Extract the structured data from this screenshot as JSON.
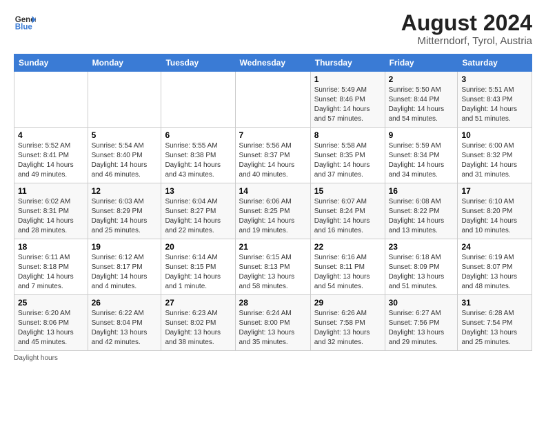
{
  "header": {
    "logo_general": "General",
    "logo_blue": "Blue",
    "month_year": "August 2024",
    "location": "Mitterndorf, Tyrol, Austria"
  },
  "days_of_week": [
    "Sunday",
    "Monday",
    "Tuesday",
    "Wednesday",
    "Thursday",
    "Friday",
    "Saturday"
  ],
  "footnote": "Daylight hours",
  "weeks": [
    [
      {
        "day": "",
        "info": ""
      },
      {
        "day": "",
        "info": ""
      },
      {
        "day": "",
        "info": ""
      },
      {
        "day": "",
        "info": ""
      },
      {
        "day": "1",
        "info": "Sunrise: 5:49 AM\nSunset: 8:46 PM\nDaylight: 14 hours\nand 57 minutes."
      },
      {
        "day": "2",
        "info": "Sunrise: 5:50 AM\nSunset: 8:44 PM\nDaylight: 14 hours\nand 54 minutes."
      },
      {
        "day": "3",
        "info": "Sunrise: 5:51 AM\nSunset: 8:43 PM\nDaylight: 14 hours\nand 51 minutes."
      }
    ],
    [
      {
        "day": "4",
        "info": "Sunrise: 5:52 AM\nSunset: 8:41 PM\nDaylight: 14 hours\nand 49 minutes."
      },
      {
        "day": "5",
        "info": "Sunrise: 5:54 AM\nSunset: 8:40 PM\nDaylight: 14 hours\nand 46 minutes."
      },
      {
        "day": "6",
        "info": "Sunrise: 5:55 AM\nSunset: 8:38 PM\nDaylight: 14 hours\nand 43 minutes."
      },
      {
        "day": "7",
        "info": "Sunrise: 5:56 AM\nSunset: 8:37 PM\nDaylight: 14 hours\nand 40 minutes."
      },
      {
        "day": "8",
        "info": "Sunrise: 5:58 AM\nSunset: 8:35 PM\nDaylight: 14 hours\nand 37 minutes."
      },
      {
        "day": "9",
        "info": "Sunrise: 5:59 AM\nSunset: 8:34 PM\nDaylight: 14 hours\nand 34 minutes."
      },
      {
        "day": "10",
        "info": "Sunrise: 6:00 AM\nSunset: 8:32 PM\nDaylight: 14 hours\nand 31 minutes."
      }
    ],
    [
      {
        "day": "11",
        "info": "Sunrise: 6:02 AM\nSunset: 8:31 PM\nDaylight: 14 hours\nand 28 minutes."
      },
      {
        "day": "12",
        "info": "Sunrise: 6:03 AM\nSunset: 8:29 PM\nDaylight: 14 hours\nand 25 minutes."
      },
      {
        "day": "13",
        "info": "Sunrise: 6:04 AM\nSunset: 8:27 PM\nDaylight: 14 hours\nand 22 minutes."
      },
      {
        "day": "14",
        "info": "Sunrise: 6:06 AM\nSunset: 8:25 PM\nDaylight: 14 hours\nand 19 minutes."
      },
      {
        "day": "15",
        "info": "Sunrise: 6:07 AM\nSunset: 8:24 PM\nDaylight: 14 hours\nand 16 minutes."
      },
      {
        "day": "16",
        "info": "Sunrise: 6:08 AM\nSunset: 8:22 PM\nDaylight: 14 hours\nand 13 minutes."
      },
      {
        "day": "17",
        "info": "Sunrise: 6:10 AM\nSunset: 8:20 PM\nDaylight: 14 hours\nand 10 minutes."
      }
    ],
    [
      {
        "day": "18",
        "info": "Sunrise: 6:11 AM\nSunset: 8:18 PM\nDaylight: 14 hours\nand 7 minutes."
      },
      {
        "day": "19",
        "info": "Sunrise: 6:12 AM\nSunset: 8:17 PM\nDaylight: 14 hours\nand 4 minutes."
      },
      {
        "day": "20",
        "info": "Sunrise: 6:14 AM\nSunset: 8:15 PM\nDaylight: 14 hours\nand 1 minute."
      },
      {
        "day": "21",
        "info": "Sunrise: 6:15 AM\nSunset: 8:13 PM\nDaylight: 13 hours\nand 58 minutes."
      },
      {
        "day": "22",
        "info": "Sunrise: 6:16 AM\nSunset: 8:11 PM\nDaylight: 13 hours\nand 54 minutes."
      },
      {
        "day": "23",
        "info": "Sunrise: 6:18 AM\nSunset: 8:09 PM\nDaylight: 13 hours\nand 51 minutes."
      },
      {
        "day": "24",
        "info": "Sunrise: 6:19 AM\nSunset: 8:07 PM\nDaylight: 13 hours\nand 48 minutes."
      }
    ],
    [
      {
        "day": "25",
        "info": "Sunrise: 6:20 AM\nSunset: 8:06 PM\nDaylight: 13 hours\nand 45 minutes."
      },
      {
        "day": "26",
        "info": "Sunrise: 6:22 AM\nSunset: 8:04 PM\nDaylight: 13 hours\nand 42 minutes."
      },
      {
        "day": "27",
        "info": "Sunrise: 6:23 AM\nSunset: 8:02 PM\nDaylight: 13 hours\nand 38 minutes."
      },
      {
        "day": "28",
        "info": "Sunrise: 6:24 AM\nSunset: 8:00 PM\nDaylight: 13 hours\nand 35 minutes."
      },
      {
        "day": "29",
        "info": "Sunrise: 6:26 AM\nSunset: 7:58 PM\nDaylight: 13 hours\nand 32 minutes."
      },
      {
        "day": "30",
        "info": "Sunrise: 6:27 AM\nSunset: 7:56 PM\nDaylight: 13 hours\nand 29 minutes."
      },
      {
        "day": "31",
        "info": "Sunrise: 6:28 AM\nSunset: 7:54 PM\nDaylight: 13 hours\nand 25 minutes."
      }
    ]
  ]
}
